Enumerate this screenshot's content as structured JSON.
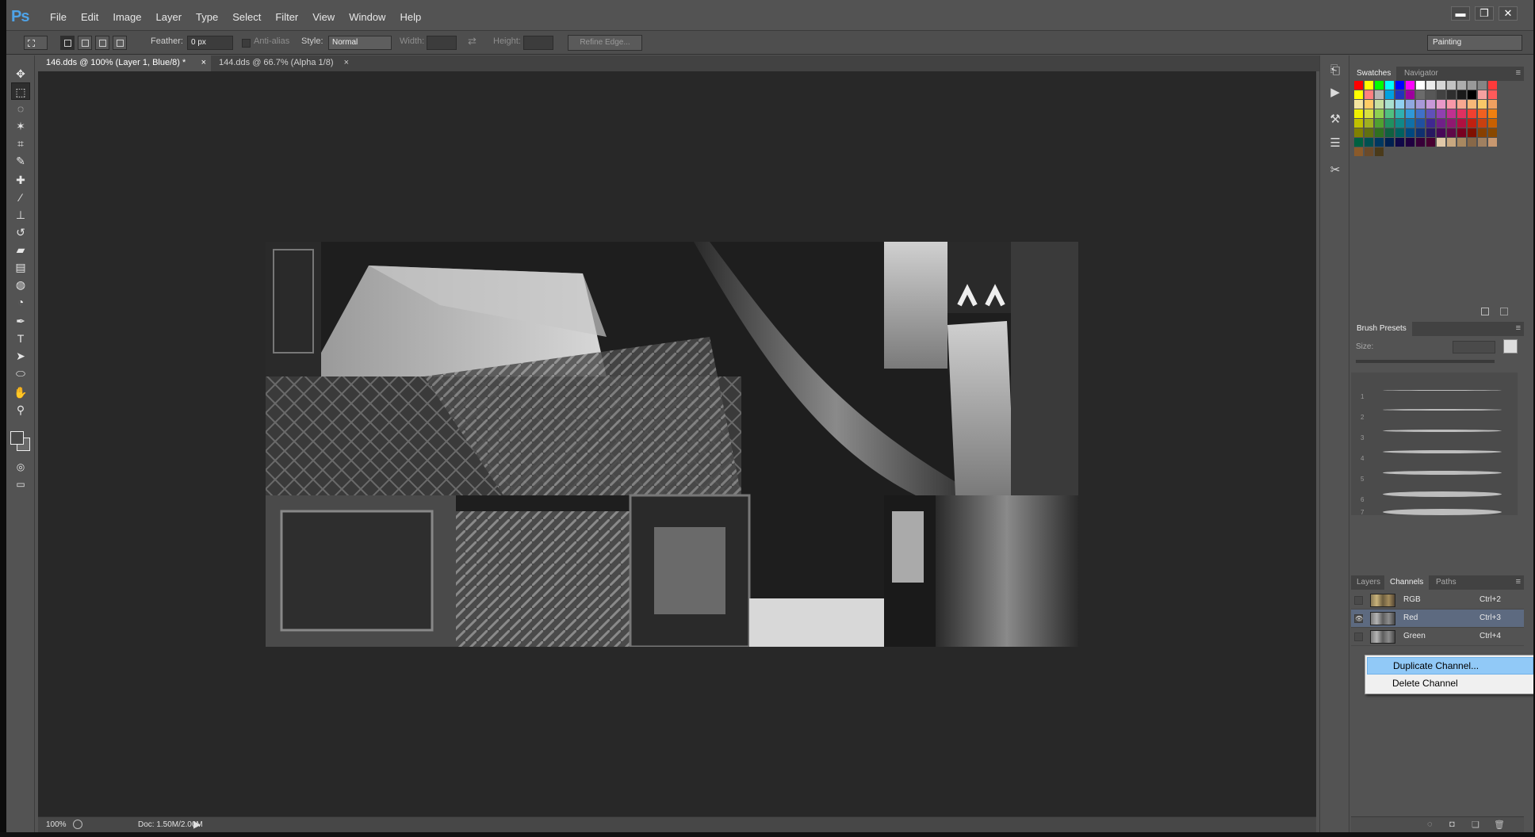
{
  "app": {
    "logo": "Ps"
  },
  "menubar": {
    "items": [
      {
        "label": "File"
      },
      {
        "label": "Edit"
      },
      {
        "label": "Image"
      },
      {
        "label": "Layer"
      },
      {
        "label": "Type"
      },
      {
        "label": "Select"
      },
      {
        "label": "Filter"
      },
      {
        "label": "View"
      },
      {
        "label": "Window"
      },
      {
        "label": "Help"
      }
    ],
    "window_buttons": {
      "minimize": "▬",
      "restore": "❐",
      "close": "✕"
    }
  },
  "options": {
    "feather_label": "Feather:",
    "feather_value": "0 px",
    "antialias_label": "Anti-alias",
    "style_label": "Style:",
    "style_value": "Normal",
    "width_label": "Width:",
    "height_label": "Height:",
    "refine_label": "Refine Edge...",
    "workspace_value": "Painting"
  },
  "tabs": [
    {
      "label": "146.dds @ 100% (Layer 1, Blue/8) *",
      "close": "×"
    },
    {
      "label": "144.dds @ 66.7% (Alpha 1/8)",
      "close": "×"
    }
  ],
  "status": {
    "zoom": "100%",
    "doc": "Doc: 1.50M/2.00M"
  },
  "panels": {
    "swatches_tab": "Swatches",
    "navigator_tab": "Navigator",
    "brush_presets_tab": "Brush Presets",
    "size_label": "Size:",
    "brush_numbers": [
      "1",
      "2",
      "3",
      "4",
      "5",
      "6",
      "7"
    ],
    "layers_tab": "Layers",
    "channels_tab": "Channels",
    "paths_tab": "Paths"
  },
  "channels": [
    {
      "name": "RGB",
      "shortcut": "Ctrl+2"
    },
    {
      "name": "Red",
      "shortcut": "Ctrl+3"
    },
    {
      "name": "Green",
      "shortcut": "Ctrl+4"
    }
  ],
  "context_menu": {
    "items": [
      {
        "label": "Duplicate Channel..."
      },
      {
        "label": "Delete Channel"
      }
    ]
  },
  "icons": {
    "tools": [
      "move-icon",
      "marquee-icon",
      "lasso-icon",
      "magic-wand-icon",
      "crop-icon",
      "eyedropper-icon",
      "healing-brush-icon",
      "brush-icon",
      "clone-stamp-icon",
      "history-brush-icon",
      "eraser-icon",
      "gradient-icon",
      "blur-icon",
      "dodge-icon",
      "pen-icon",
      "type-icon",
      "path-selection-icon",
      "ellipse-icon",
      "hand-icon",
      "zoom-icon"
    ]
  },
  "swatch_colors": [
    [
      "#ff0000",
      "#ffff00",
      "#00ff00",
      "#00ffff",
      "#0000ff",
      "#ff00ff",
      "#ffffff",
      "#ebebeb",
      "#d6d6d6",
      "#c2c2c2",
      "#adadad",
      "#999999",
      "#858585",
      "#ff3a3a"
    ],
    [
      "#ffff00",
      "#ff8080",
      "#b5b5b5",
      "#00a0e0",
      "#2233bb",
      "#9e009e",
      "#6b6b6b",
      "#575757",
      "#424242",
      "#2e2e2e",
      "#1a1a1a",
      "#000000",
      "#f5a0a0",
      "#ff5a5a"
    ],
    [
      "#f4e4a0",
      "#ffcc66",
      "#c8e0a0",
      "#a8e0d0",
      "#90d0f0",
      "#90a8e0",
      "#a898d8",
      "#c898d8",
      "#e898c8",
      "#f898a8",
      "#f8a890",
      "#f8b878",
      "#f8c868",
      "#f0a060"
    ],
    [
      "#f0f000",
      "#d8e040",
      "#90d050",
      "#50c080",
      "#30b0b0",
      "#3098d8",
      "#4070c8",
      "#6050b8",
      "#9040b0",
      "#c03090",
      "#e03060",
      "#f04030",
      "#f06020",
      "#f08010"
    ],
    [
      "#c0c000",
      "#a0b020",
      "#50a030",
      "#209060",
      "#108888",
      "#1070a8",
      "#2050a0",
      "#402890",
      "#702088",
      "#901870",
      "#b01040",
      "#c02010",
      "#c84010",
      "#c86000"
    ],
    [
      "#808000",
      "#607010",
      "#307020",
      "#106040",
      "#006060",
      "#004880",
      "#103070",
      "#281860",
      "#480858",
      "#600848",
      "#780020",
      "#801000",
      "#884000",
      "#884800"
    ],
    [
      "#006040",
      "#005050",
      "#003860",
      "#002050",
      "#100848",
      "#200040",
      "#380038",
      "#480030",
      "#e0c8a8",
      "#c8a880",
      "#a88860",
      "#886848",
      "#a08060",
      "#c89870"
    ],
    [
      "#8a5a2a",
      "#6a4a2a",
      "#4a3a1a"
    ]
  ]
}
